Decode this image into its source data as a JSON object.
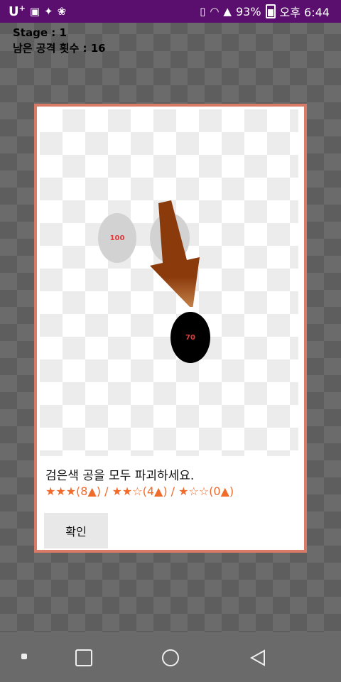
{
  "status_bar": {
    "carrier": "U",
    "carrier_sup": "+",
    "icons_left": [
      "image-icon",
      "twitter-icon",
      "app-icon"
    ],
    "battery_percent": "93%",
    "time": "오후 6:44"
  },
  "game_info": {
    "stage": "Stage : 1",
    "attacks_left": "남은 공격 횟수 : 16"
  },
  "dialog": {
    "balls": [
      {
        "label": "100",
        "color": "grey"
      },
      {
        "label": "1",
        "color": "grey"
      },
      {
        "label": "70",
        "color": "black"
      }
    ],
    "message": "검은색 공을 모두 파괴하세요.",
    "stars": "★★★(8▲) / ★★☆(4▲) / ★☆☆(0▲)",
    "confirm_label": "확인"
  },
  "colors": {
    "status_bar": "#5a0f6e",
    "dialog_border": "#d97a66",
    "stars": "#f06a2a",
    "arrow": "#8b3a0c"
  }
}
